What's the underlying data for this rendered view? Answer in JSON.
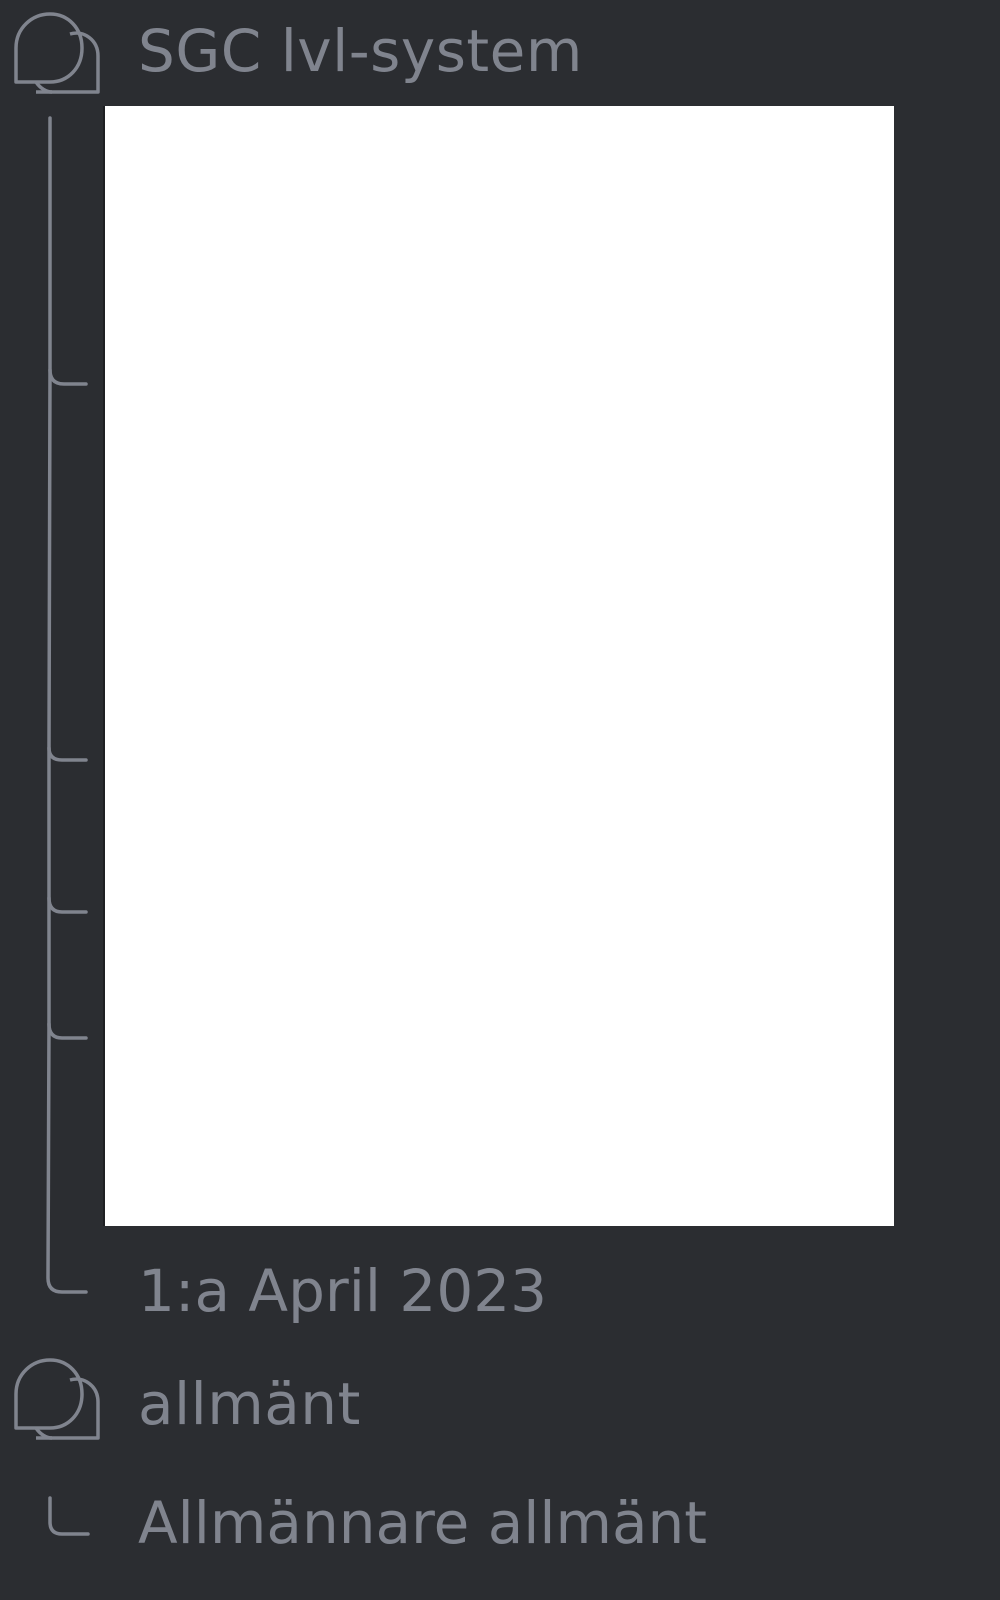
{
  "channels": [
    {
      "name": "SGC lvl-system",
      "icon": "forum-icon",
      "threads": [
        {
          "label": ""
        },
        {
          "label": ""
        },
        {
          "label": ""
        },
        {
          "label": ""
        },
        {
          "label": "1:a April 2023"
        }
      ]
    },
    {
      "name": "allmänt",
      "icon": "forum-icon",
      "threads": [
        {
          "label": "Allmännare allmänt"
        }
      ]
    }
  ],
  "colors": {
    "background": "#2b2d31",
    "text": "#80848e",
    "popup": "#ffffff"
  }
}
